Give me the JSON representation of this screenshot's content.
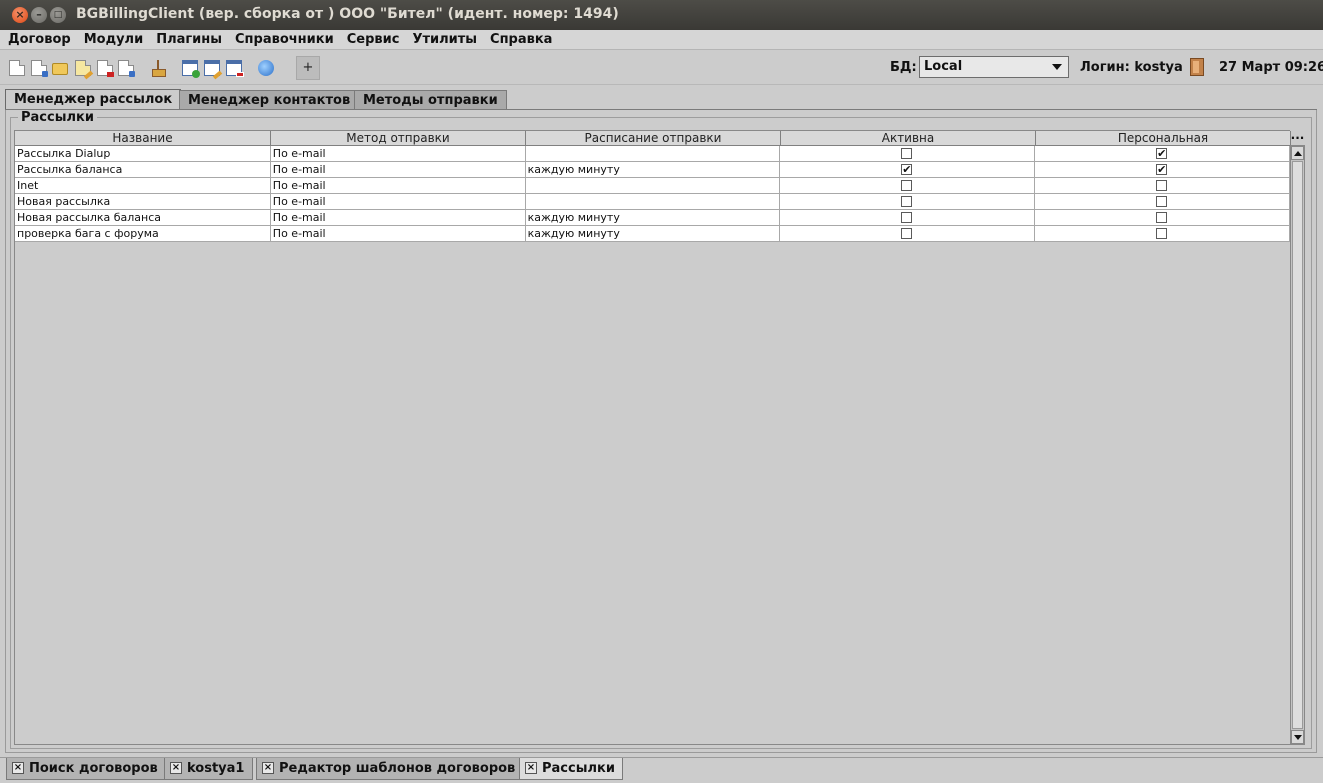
{
  "window": {
    "title": "BGBillingClient (вер.  сборка  от ) ООО \"Бител\" (идент. номер: 1494)",
    "close": "×",
    "minimize": "–",
    "maximize": "□"
  },
  "menubar": [
    "Договор",
    "Модули",
    "Плагины",
    "Справочники",
    "Сервис",
    "Утилиты",
    "Справка"
  ],
  "toolbar": {
    "icons": [
      "new-doc-icon",
      "copy-doc-icon",
      "open-folder-icon",
      "edit-doc-icon",
      "delete-doc-icon",
      "move-doc-icon",
      "broom-icon",
      "add-window-icon",
      "edit-window-icon",
      "remove-window-icon",
      "refresh-icon"
    ],
    "plus_label": "+",
    "db_label": "БД:",
    "db_value": "Local",
    "login_label": "Логин: kostya",
    "datetime": "27 Март 09:26"
  },
  "tabs": [
    {
      "label": "Менеджер рассылок",
      "active": true
    },
    {
      "label": "Менеджер контактов",
      "active": false
    },
    {
      "label": "Методы отправки",
      "active": false
    }
  ],
  "group": {
    "title": "Рассылки"
  },
  "table": {
    "columns": [
      "Название",
      "Метод отправки",
      "Расписание отправки",
      "Активна",
      "Персональная"
    ],
    "column_menu": "...",
    "rows": [
      {
        "name": "Рассылка Dialup",
        "method": "По e-mail",
        "schedule": "",
        "active": false,
        "personal": true
      },
      {
        "name": "Рассылка баланса",
        "method": "По e-mail",
        "schedule": "каждую минуту",
        "active": true,
        "personal": true
      },
      {
        "name": "Inet",
        "method": "По e-mail",
        "schedule": "",
        "active": false,
        "personal": false
      },
      {
        "name": "Новая рассылка",
        "method": "По e-mail",
        "schedule": "",
        "active": false,
        "personal": false
      },
      {
        "name": "Новая рассылка баланса",
        "method": "По e-mail",
        "schedule": "каждую минуту",
        "active": false,
        "personal": false
      },
      {
        "name": "проверка бага с форума",
        "method": "По e-mail",
        "schedule": "каждую минуту",
        "active": false,
        "personal": false
      }
    ]
  },
  "bottom_tabs": [
    {
      "label": "Поиск договоров",
      "active": false
    },
    {
      "label": "kostya1",
      "active": false
    },
    {
      "label": "Редактор шаблонов договоров",
      "active": false
    },
    {
      "label": "Рассылки",
      "active": true
    }
  ],
  "bottom_tab_close": "×"
}
